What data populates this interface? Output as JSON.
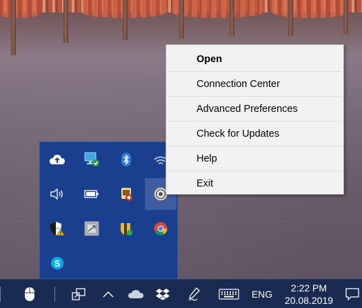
{
  "context_menu": {
    "items": [
      {
        "label": "Open",
        "bold": true
      },
      {
        "label": "Connection Center",
        "bold": false
      },
      {
        "label": "Advanced Preferences",
        "bold": false
      },
      {
        "label": "Check for Updates",
        "bold": false
      },
      {
        "label": "Help",
        "bold": false
      },
      {
        "label": "Exit",
        "bold": false
      }
    ]
  },
  "tray_overflow": {
    "icons": [
      {
        "name": "onedrive-upload-icon"
      },
      {
        "name": "remote-connection-icon"
      },
      {
        "name": "bluetooth-icon"
      },
      {
        "name": "wifi-icon"
      },
      {
        "name": "volume-icon"
      },
      {
        "name": "battery-icon"
      },
      {
        "name": "security-app-icon"
      },
      {
        "name": "citrix-receiver-icon",
        "selected": true
      },
      {
        "name": "windows-defender-warning-icon"
      },
      {
        "name": "display-sync-icon"
      },
      {
        "name": "folder-shield-icon"
      },
      {
        "name": "chrome-icon"
      },
      {
        "name": "skype-icon"
      }
    ]
  },
  "taskbar": {
    "language": "ENG",
    "time": "2:22 PM",
    "date": "20.08.2019",
    "colors": {
      "taskbar_bg": "#1a2b52",
      "flyout_bg": "#1b3f8f",
      "menu_bg": "#f2f2f2"
    }
  }
}
